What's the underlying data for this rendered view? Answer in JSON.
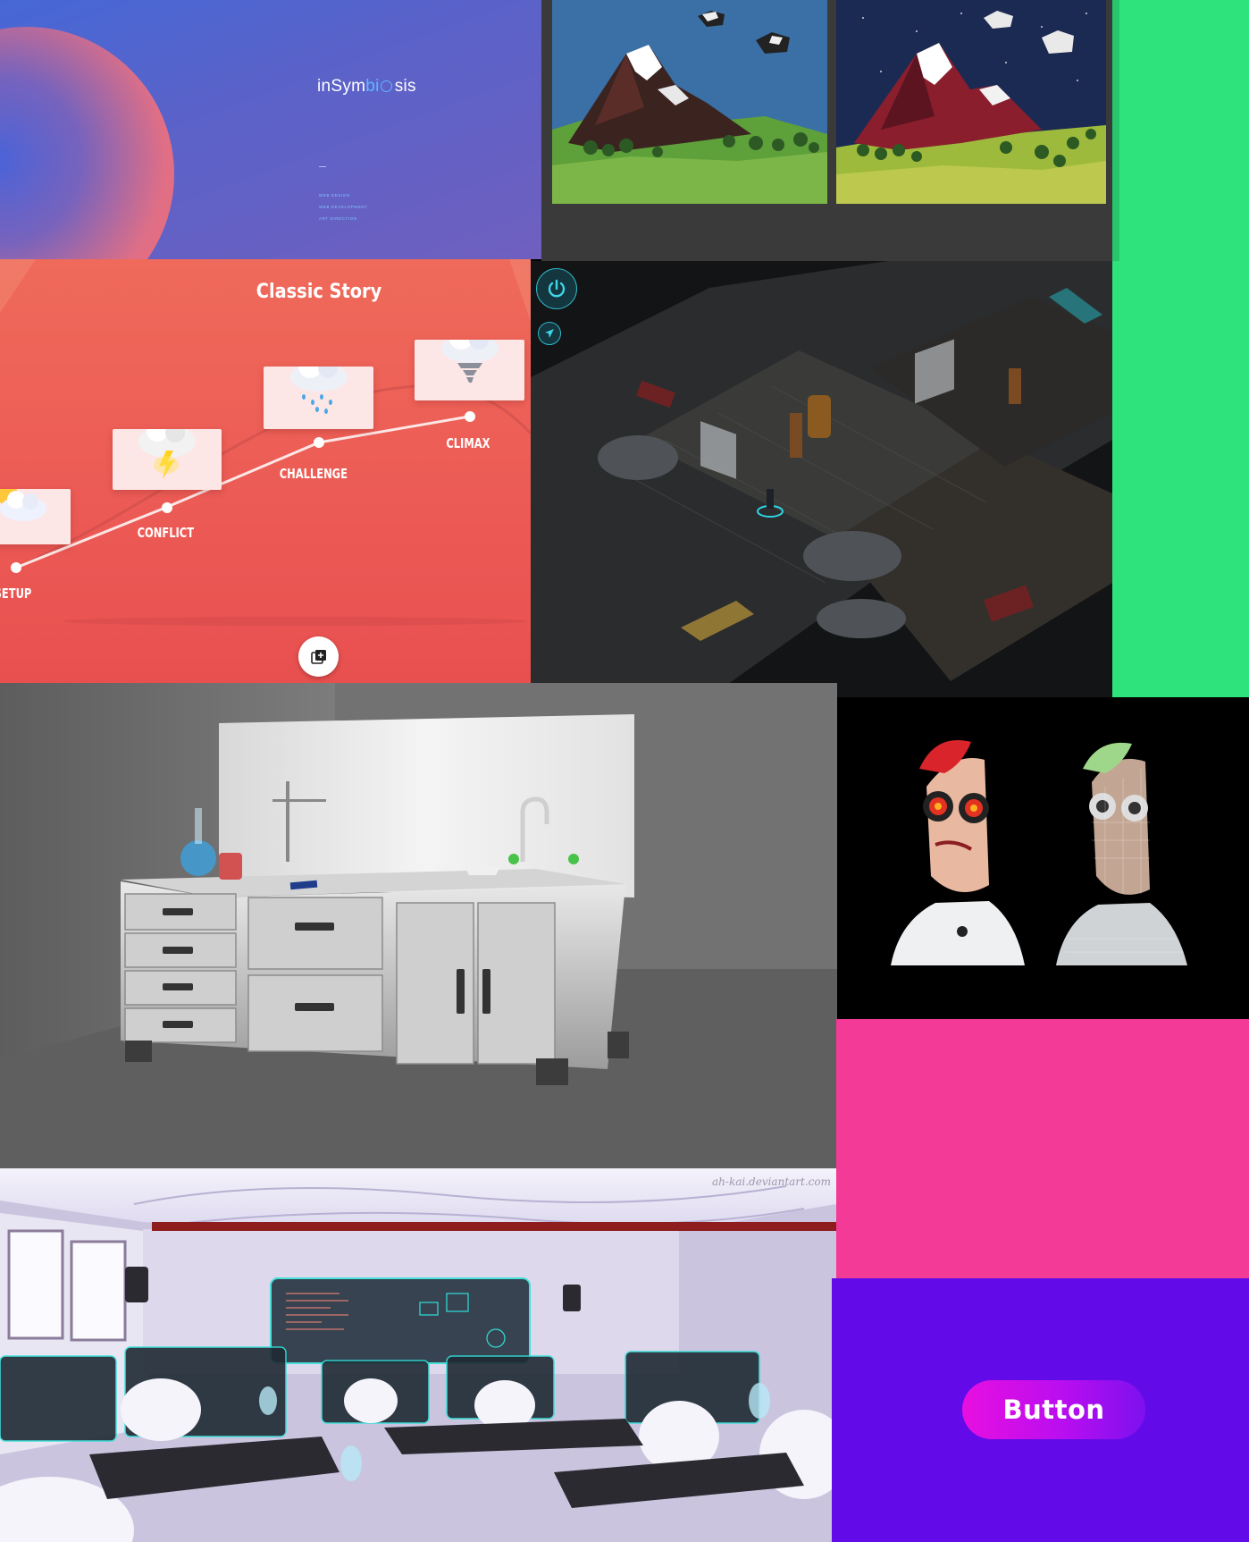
{
  "insymbiosis": {
    "logo_prefix": "inSym",
    "logo_highlight": "bi",
    "logo_suffix": "sis",
    "menu": [
      "WEB DESIGN",
      "WEB DEVELOPMENT",
      "ART DIRECTION"
    ]
  },
  "story": {
    "title": "Classic Story",
    "stages": [
      "SETUP",
      "CONFLICT",
      "CHALLENGE",
      "CLIMAX"
    ],
    "fab_icon": "add-to-library-icon"
  },
  "game": {
    "power_icon": "power-icon",
    "navigate_icon": "navigation-arrow-icon"
  },
  "classroom": {
    "watermark": "ah-kai.deviantart.com"
  },
  "cta": {
    "button_label": "Button"
  },
  "colors": {
    "green": "#2ee37b",
    "pink": "#f23a96",
    "purple": "#620be8",
    "button_gradient_start": "#e80fe0",
    "button_gradient_end": "#7d10ef",
    "story_red": "#ec5a55"
  }
}
